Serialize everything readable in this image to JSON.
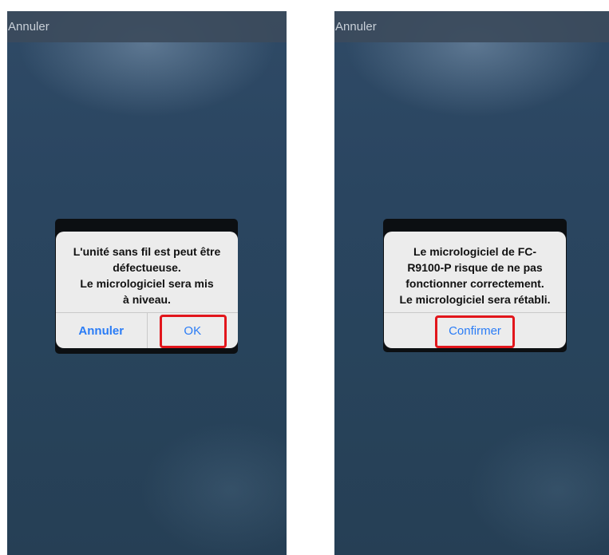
{
  "colors": {
    "background": "#2a4560",
    "alert_button": "#2a7cf6",
    "highlight": "#e2161c"
  },
  "left_screen": {
    "topbar": {
      "cancel_label": "Annuler"
    },
    "dialog": {
      "line1": "L'unité sans fil est peut être",
      "line2": "défectueuse.",
      "line3": "Le micrologiciel sera mis",
      "line4": "à niveau.",
      "cancel_label": "Annuler",
      "ok_label": "OK"
    }
  },
  "right_screen": {
    "topbar": {
      "cancel_label": "Annuler"
    },
    "dialog": {
      "line1": "Le micrologiciel de FC-",
      "line2": "R9100-P risque de ne pas",
      "line3": "fonctionner correctement.",
      "line4": "Le micrologiciel sera rétabli.",
      "confirm_label": "Confirmer"
    }
  }
}
